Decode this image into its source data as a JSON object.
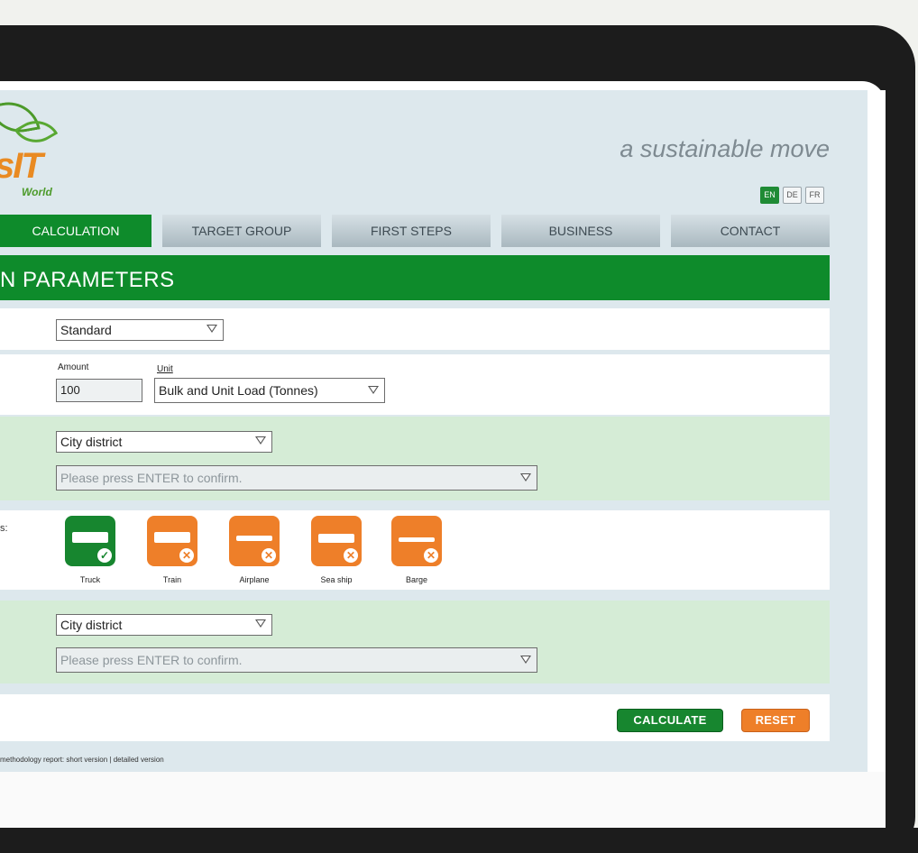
{
  "brand": {
    "logo_text": "sIT",
    "logo_sub": "World",
    "tagline": "a sustainable move"
  },
  "languages": [
    "EN",
    "DE",
    "FR"
  ],
  "nav": {
    "tabs": [
      "CALCULATION",
      "TARGET GROUP",
      "FIRST STEPS",
      "BUSINESS",
      "CONTACT"
    ],
    "active": "CALCULATION"
  },
  "section": {
    "title": "N PARAMETERS"
  },
  "settings": {
    "mode_value": "Standard"
  },
  "cargo": {
    "amount_label": "Amount",
    "amount_value": "100",
    "unit_label": "Unit",
    "unit_value": "Bulk and Unit Load (Tonnes)"
  },
  "origin": {
    "type_value": "City district",
    "location_placeholder": "Please press ENTER to confirm."
  },
  "transport": {
    "label_fragment": "s:",
    "modes": [
      {
        "label": "Truck",
        "state": "selected",
        "icon": "truck-icon"
      },
      {
        "label": "Train",
        "state": "excluded",
        "icon": "train-icon"
      },
      {
        "label": "Airplane",
        "state": "excluded",
        "icon": "airplane-icon"
      },
      {
        "label": "Sea ship",
        "state": "excluded",
        "icon": "sea-ship-icon"
      },
      {
        "label": "Barge",
        "state": "excluded",
        "icon": "barge-icon"
      }
    ]
  },
  "destination": {
    "type_value": "City district",
    "location_placeholder": "Please press ENTER to confirm."
  },
  "actions": {
    "calculate": "CALCULATE",
    "reset": "RESET"
  },
  "footer": {
    "text": "methodology report: short version | detailed version"
  },
  "colors": {
    "primary_green": "#0e8b2b",
    "accent_orange": "#ee7f29",
    "light_green": "#d5ecd6",
    "page_blue": "#dde8ed"
  }
}
